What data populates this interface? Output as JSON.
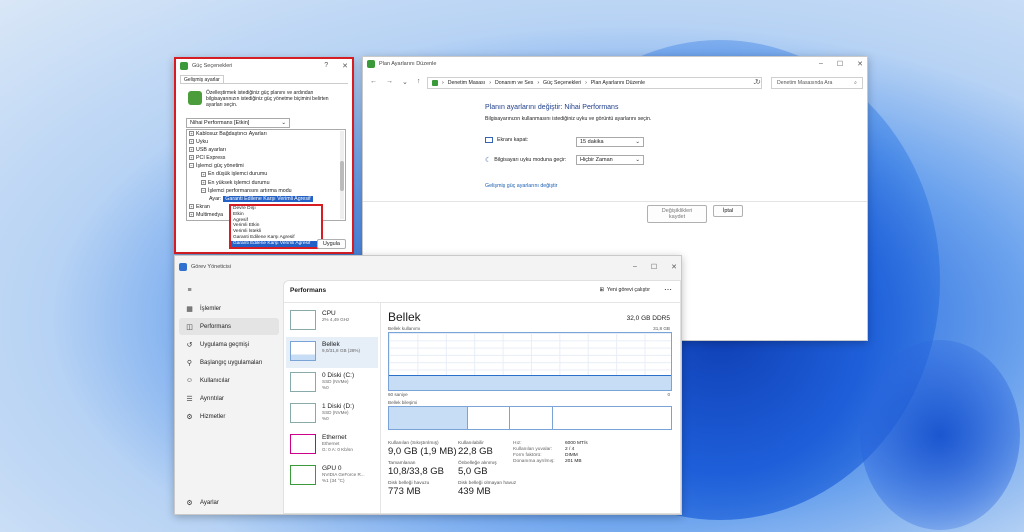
{
  "power": {
    "title": "Güç Seçenekleri",
    "tab": "Gelişmiş ayarlar",
    "description": "Özelleştirmek istediğiniz güç planını ve ardından bilgisayarınızın istediğiniz güç yönetme biçimini belirten ayarları seçin.",
    "plan_select": "Nihai Performans [Etkin]",
    "tree": [
      {
        "label": "Kablosuz Bağdaştırıcı Ayarları",
        "level": 0,
        "sign": "+"
      },
      {
        "label": "Uyku",
        "level": 0,
        "sign": "+"
      },
      {
        "label": "USB ayarları",
        "level": 0,
        "sign": "+"
      },
      {
        "label": "PCI Express",
        "level": 0,
        "sign": "+"
      },
      {
        "label": "İşlemci güç yönetimi",
        "level": 0,
        "sign": "−"
      },
      {
        "label": "En düşük işlemci durumu",
        "level": 1,
        "sign": "+"
      },
      {
        "label": "En yüksek işlemci durumu",
        "level": 1,
        "sign": "+"
      },
      {
        "label": "İşlemci performansını artırma modu",
        "level": 1,
        "sign": "−"
      }
    ],
    "setting_label": "Ayar:",
    "setting_value": "Garanti Edilene Karşı Verimli Agresif",
    "tree_tail": [
      "Ekran",
      "Multimedya"
    ],
    "options": [
      "Devre Dışı",
      "Etkin",
      "Agresif",
      "Verimli Etkin",
      "Verimli İstekli",
      "Garanti Edilene Karşı Agresif",
      "Garanti Edilene Karşı Verimli Agresif"
    ],
    "apply_button": "Uygula"
  },
  "cpanel": {
    "title": "Plan Ayarlarını Düzenle",
    "breadcrumb": [
      "Denetim Masası",
      "Donanım ve Ses",
      "Güç Seçenekleri",
      "Plan Ayarlarını Düzenle"
    ],
    "search_placeholder": "Denetim Masasında Ara",
    "heading": "Planın ayarlarını değiştir: Nihai Performans",
    "subheading": "Bilgisayarınızın kullanmasını istediğiniz uyku ve görüntü ayarlarını seçin.",
    "display_off_label": "Ekranı kapat:",
    "display_off_value": "15 dakika",
    "sleep_label": "Bilgisayarı uyku moduna geçir:",
    "sleep_value": "Hiçbir Zaman",
    "advanced_link": "Gelişmiş güç ayarlarını değiştir",
    "save_button": "Değişiklikleri kaydet",
    "cancel_button": "İptal"
  },
  "taskmgr": {
    "title": "Görev Yöneticisi",
    "nav": [
      {
        "label": "İşlemler",
        "icon": "grid-icon"
      },
      {
        "label": "Performans",
        "icon": "performance-icon"
      },
      {
        "label": "Uygulama geçmişi",
        "icon": "history-icon"
      },
      {
        "label": "Başlangıç uygulamaları",
        "icon": "startup-icon"
      },
      {
        "label": "Kullanıcılar",
        "icon": "users-icon"
      },
      {
        "label": "Ayrıntılar",
        "icon": "details-icon"
      },
      {
        "label": "Hizmetler",
        "icon": "services-icon"
      }
    ],
    "settings": "Ayarlar",
    "section": "Performans",
    "new_task": "Yeni görevi çalıştır",
    "resources": [
      {
        "name": "CPU",
        "sub1": "2% 4,49 GHz",
        "sub2": ""
      },
      {
        "name": "Bellek",
        "sub1": "9,0/31,8 GB (28%)",
        "sub2": ""
      },
      {
        "name": "0 Diski (C:)",
        "sub1": "SSD (NVMe)",
        "sub2": "%0"
      },
      {
        "name": "1 Diski (D:)",
        "sub1": "SSD (NVMe)",
        "sub2": "%0"
      },
      {
        "name": "Ethernet",
        "sub1": "Ethernet",
        "sub2": "G: 0 A: 0 Kb/sn"
      },
      {
        "name": "GPU 0",
        "sub1": "NVIDIA GeForce R...",
        "sub2": "%1 (34 °C)"
      }
    ],
    "mem_title": "Bellek",
    "mem_total": "32,0 GB DDR5",
    "usage_label": "Bellek kullanımı",
    "usage_max": "31,8 GB",
    "axis_left": "60 saniye",
    "axis_right": "0",
    "composition": "Bellek bileşimi",
    "stats": [
      {
        "label": "Kullanılan (Sıkıştırılmış)",
        "value": "9,0 GB (1,9 MB)"
      },
      {
        "label": "Kullanılabilir",
        "value": "22,8 GB"
      },
      {
        "label": "Tamamlanan",
        "value": "10,8/33,8 GB"
      },
      {
        "label": "Önbelleğe alınmış",
        "value": "5,0 GB"
      },
      {
        "label": "Disk belleği havuzu",
        "value": "773 MB"
      },
      {
        "label": "Disk belleği olmayan havuz",
        "value": "439 MB"
      }
    ],
    "details": [
      {
        "k": "Hız:",
        "v": "6000 MT/s"
      },
      {
        "k": "Kullanılan yuvalar:",
        "v": "2 / 4"
      },
      {
        "k": "Form faktörü:",
        "v": "DIMM"
      },
      {
        "k": "Donanıma ayrılmış:",
        "v": "201 MB"
      }
    ]
  }
}
